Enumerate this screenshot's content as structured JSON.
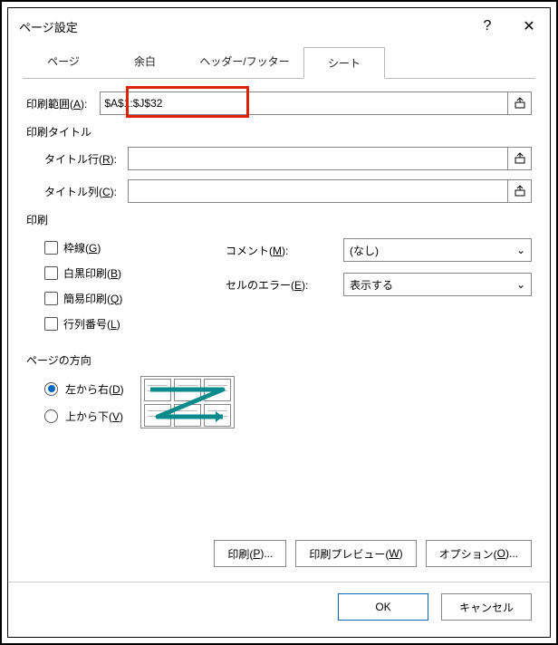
{
  "title": "ページ設定",
  "titlebar": {
    "help": "?",
    "close": "✕"
  },
  "tabs": {
    "page": "ページ",
    "margins": "余白",
    "hf": "ヘッダー/フッター",
    "sheet": "シート"
  },
  "printArea": {
    "label_pre": "印刷範囲(",
    "label_u": "A",
    "label_post": "):",
    "value": "$A$1:$J$32"
  },
  "printTitles": {
    "heading": "印刷タイトル",
    "rows": {
      "pre": "タイトル行(",
      "u": "R",
      "post": "):",
      "value": ""
    },
    "cols": {
      "pre": "タイトル列(",
      "u": "C",
      "post": "):",
      "value": ""
    }
  },
  "printSection": {
    "heading": "印刷",
    "gridlines": {
      "pre": "枠線(",
      "u": "G",
      "post": ")"
    },
    "bw": {
      "pre": "白黒印刷(",
      "u": "B",
      "post": ")"
    },
    "draft": {
      "pre": "簡易印刷(",
      "u": "Q",
      "post": ")"
    },
    "rowcol": {
      "pre": "行列番号(",
      "u": "L",
      "post": ")"
    },
    "comments": {
      "pre": "コメント(",
      "u": "M",
      "post": "):",
      "value": "(なし)"
    },
    "errors": {
      "pre": "セルのエラー(",
      "u": "E",
      "post": "):",
      "value": "表示する"
    }
  },
  "pageOrder": {
    "heading": "ページの方向",
    "ltr": {
      "pre": "左から右(",
      "u": "D",
      "post": ")"
    },
    "ttb": {
      "pre": "上から下(",
      "u": "V",
      "post": ")"
    }
  },
  "buttons": {
    "print": {
      "pre": "印刷(",
      "u": "P",
      "post": ")..."
    },
    "preview": {
      "pre": "印刷プレビュー(",
      "u": "W",
      "post": ")"
    },
    "options": {
      "pre": "オプション(",
      "u": "O",
      "post": ")..."
    },
    "ok": "OK",
    "cancel": "キャンセル"
  }
}
